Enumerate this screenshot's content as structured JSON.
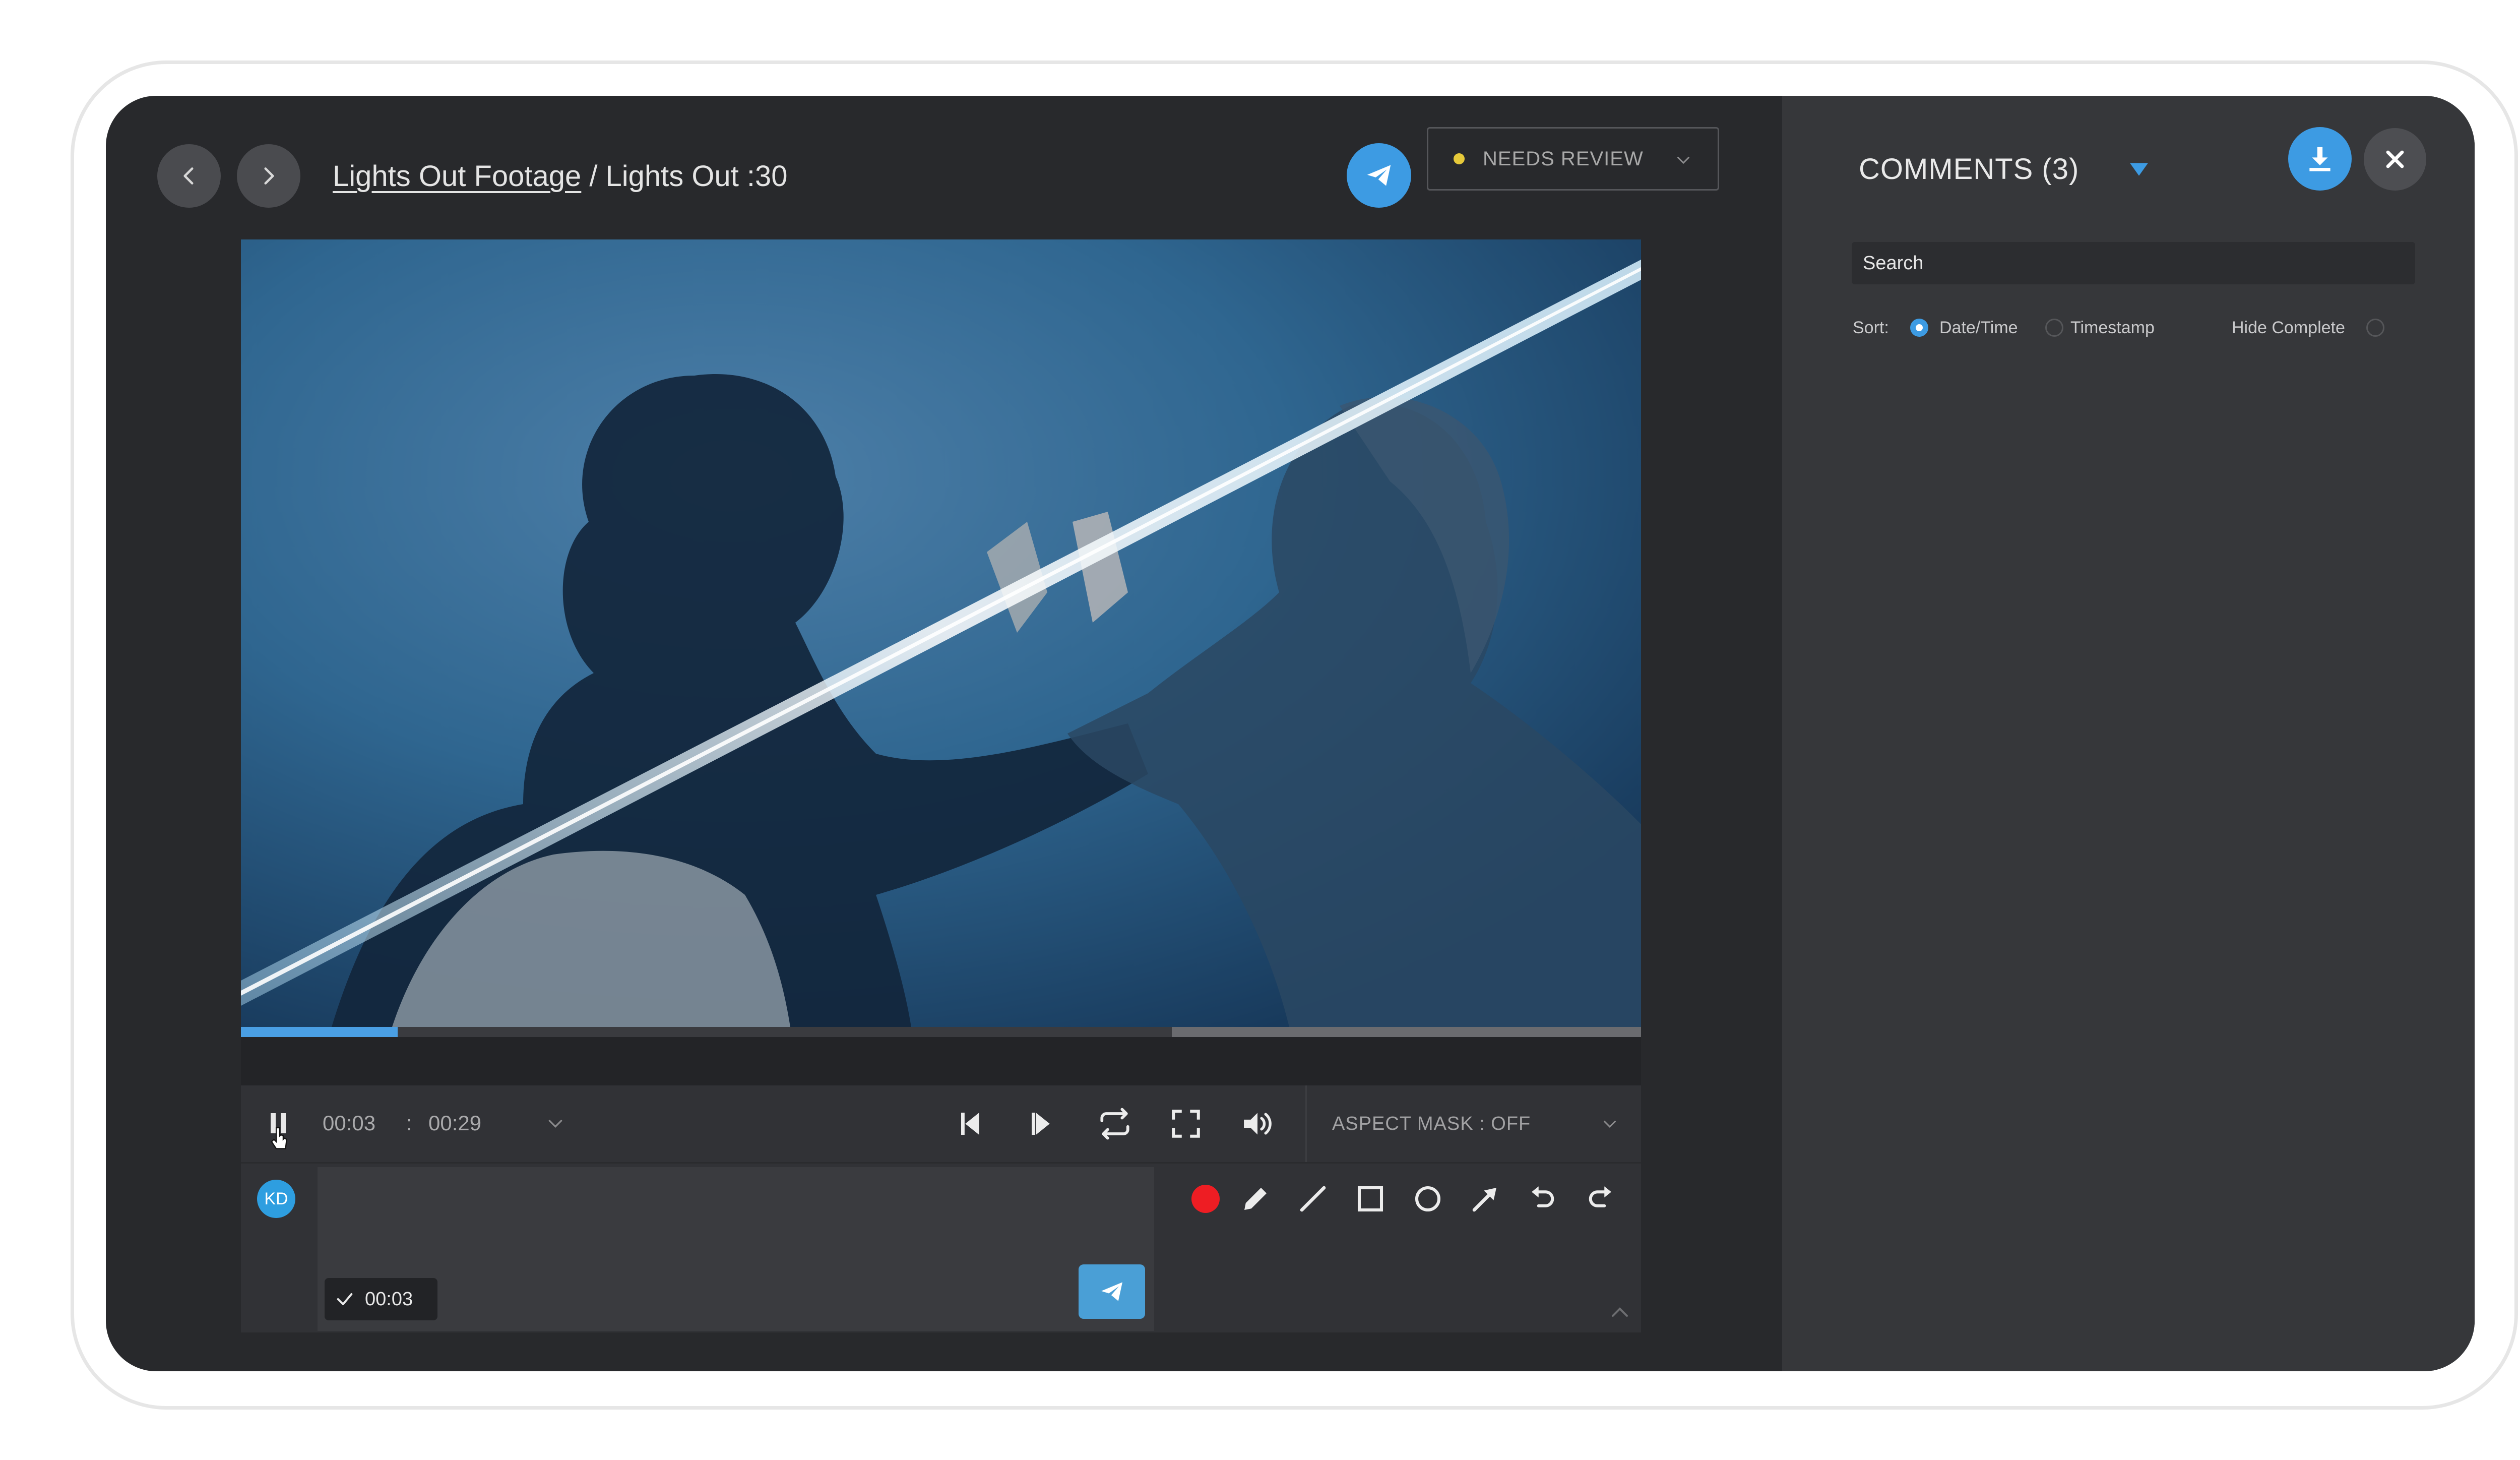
{
  "window": {
    "breadcrumb_parent": "Lights Out Footage",
    "breadcrumb_separator": "/",
    "breadcrumb_current": "Lights Out :30"
  },
  "status": {
    "label": "NEEDS REVIEW",
    "dot_color": "#e6c93a"
  },
  "player": {
    "current_time": "00:03",
    "time_separator": ":",
    "duration": "00:29",
    "progress_fraction": 0.112,
    "buffer_start_fraction": 0.665,
    "aspect_mask_label": "ASPECT MASK : OFF",
    "play_state_icon": "pause-icon"
  },
  "comment_composer": {
    "avatar_initials": "KD",
    "timestamp": "00:03",
    "tools": [
      "record-icon",
      "pencil-icon",
      "line-icon",
      "rectangle-icon",
      "circle-icon",
      "arrow-icon",
      "undo-icon",
      "redo-icon"
    ]
  },
  "comments_panel": {
    "title": "COMMENTS (3)",
    "search_placeholder": "Search",
    "sort_label": "Sort:",
    "sort_options": [
      "Date/Time",
      "Timestamp"
    ],
    "sort_selected": "Date/Time",
    "hide_complete_label": "Hide Complete"
  },
  "colors": {
    "accent": "#3d9be3",
    "background": "#28292c",
    "panel": "#36373a",
    "record": "#ee1d23"
  }
}
